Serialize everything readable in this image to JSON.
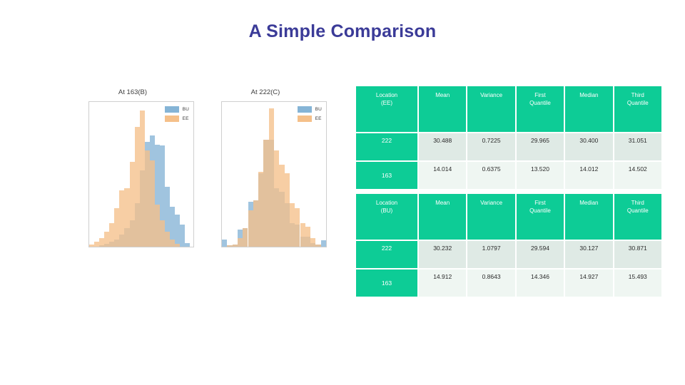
{
  "slide": {
    "title": "A Simple Comparison",
    "title_color": "#3b3b98",
    "background": "#ffffff"
  },
  "colors": {
    "series_bu": "#85b4d6",
    "series_ee": "#f5c08a",
    "table_header_green": "#0dcc96",
    "table_row_odd": "#dfeae5",
    "table_row_even": "#eff6f2"
  },
  "charts": {
    "legend": {
      "bu_label": "BU",
      "ee_label": "EE"
    },
    "panel1": {
      "title": "At 163(B)",
      "yticks": [
        "0.0",
        "0.1",
        "0.2",
        "0.3",
        "0.4",
        "0.5"
      ],
      "xticks": [
        "12",
        "14",
        "16"
      ]
    },
    "panel2": {
      "title": "At 222(C)",
      "yticks": [
        "0.0",
        "0.1",
        "0.2",
        "0.3",
        "0.4",
        "0.5"
      ],
      "xticks": [
        "28",
        "30",
        "32"
      ]
    }
  },
  "chart_data": [
    {
      "type": "bar",
      "title": "At 163(B)",
      "xlabel": "",
      "ylabel": "",
      "xlim": [
        11.2,
        17.4
      ],
      "ylim": [
        0.0,
        0.58
      ],
      "xticks": [
        12,
        14,
        16
      ],
      "yticks": [
        0.0,
        0.1,
        0.2,
        0.3,
        0.4,
        0.5
      ],
      "grid": false,
      "legend_position": "upper right",
      "bin_edges": [
        11.2,
        11.5,
        11.8,
        12.1,
        12.4,
        12.7,
        13.0,
        13.3,
        13.6,
        13.9,
        14.2,
        14.5,
        14.8,
        15.1,
        15.4,
        15.7,
        16.0,
        16.3,
        16.6,
        16.9,
        17.2
      ],
      "series": [
        {
          "name": "BU",
          "color": "#85b4d6",
          "values": [
            0.0,
            0.0,
            0.005,
            0.012,
            0.02,
            0.03,
            0.05,
            0.075,
            0.105,
            0.175,
            0.305,
            0.42,
            0.445,
            0.41,
            0.405,
            0.24,
            0.16,
            0.13,
            0.09,
            0.015
          ]
        },
        {
          "name": "EE",
          "color": "#f5c08a",
          "values": [
            0.01,
            0.02,
            0.035,
            0.06,
            0.095,
            0.155,
            0.225,
            0.235,
            0.34,
            0.48,
            0.545,
            0.385,
            0.345,
            0.17,
            0.105,
            0.06,
            0.03,
            0.012,
            0.0,
            0.0
          ]
        }
      ]
    },
    {
      "type": "bar",
      "title": "At 222(C)",
      "xlabel": "",
      "ylabel": "",
      "xlim": [
        27.2,
        33.6
      ],
      "ylim": [
        0.0,
        0.58
      ],
      "xticks": [
        28,
        30,
        32
      ],
      "yticks": [
        0.0,
        0.1,
        0.2,
        0.3,
        0.4,
        0.5
      ],
      "grid": false,
      "legend_position": "upper right",
      "bin_edges": [
        27.2,
        27.52,
        27.84,
        28.16,
        28.48,
        28.8,
        29.12,
        29.44,
        29.76,
        30.08,
        30.4,
        30.72,
        31.04,
        31.36,
        31.68,
        32.0,
        32.32,
        32.64,
        32.96,
        33.28,
        33.6
      ],
      "series": [
        {
          "name": "BU",
          "color": "#85b4d6",
          "values": [
            0.03,
            0.005,
            0.01,
            0.07,
            0.075,
            0.18,
            0.185,
            0.295,
            0.43,
            0.43,
            0.235,
            0.22,
            0.175,
            0.095,
            0.09,
            0.04,
            0.04,
            0.015,
            0.008,
            0.025
          ]
        },
        {
          "name": "EE",
          "color": "#f5c08a",
          "values": [
            0.0,
            0.005,
            0.01,
            0.035,
            0.075,
            0.145,
            0.185,
            0.3,
            0.43,
            0.555,
            0.385,
            0.33,
            0.295,
            0.175,
            0.155,
            0.095,
            0.08,
            0.035,
            0.008,
            0.0
          ]
        }
      ]
    }
  ],
  "tables": [
    {
      "id": "table-ee",
      "headers": [
        "Location\n(EE)",
        "Mean",
        "Variance",
        "First\nQuantile",
        "Median",
        "Third\nQuantile"
      ],
      "header_line1": [
        "Location",
        "Mean",
        "Variance",
        "First",
        "Median",
        "Third"
      ],
      "header_line2": [
        "(EE)",
        "",
        "",
        "Quantile",
        "",
        "Quantile"
      ],
      "rows": [
        {
          "location": "222",
          "mean": "30.488",
          "variance": "0.7225",
          "first_quantile": "29.965",
          "median": "30.400",
          "third_quantile": "31.051"
        },
        {
          "location": "163",
          "mean": "14.014",
          "variance": "0.6375",
          "first_quantile": "13.520",
          "median": "14.012",
          "third_quantile": "14.502"
        }
      ]
    },
    {
      "id": "table-bu",
      "headers": [
        "Location\n(BU)",
        "Mean",
        "Variance",
        "First\nQuantile",
        "Median",
        "Third\nQuantile"
      ],
      "header_line1": [
        "Location",
        "Mean",
        "Variance",
        "First",
        "Median",
        "Third"
      ],
      "header_line2": [
        "(BU)",
        "",
        "",
        "Quantile",
        "",
        "Quantile"
      ],
      "rows": [
        {
          "location": "222",
          "mean": "30.232",
          "variance": "1.0797",
          "first_quantile": "29.594",
          "median": "30.127",
          "third_quantile": "30.871"
        },
        {
          "location": "163",
          "mean": "14.912",
          "variance": "0.8643",
          "first_quantile": "14.346",
          "median": "14.927",
          "third_quantile": "15.493"
        }
      ]
    }
  ]
}
